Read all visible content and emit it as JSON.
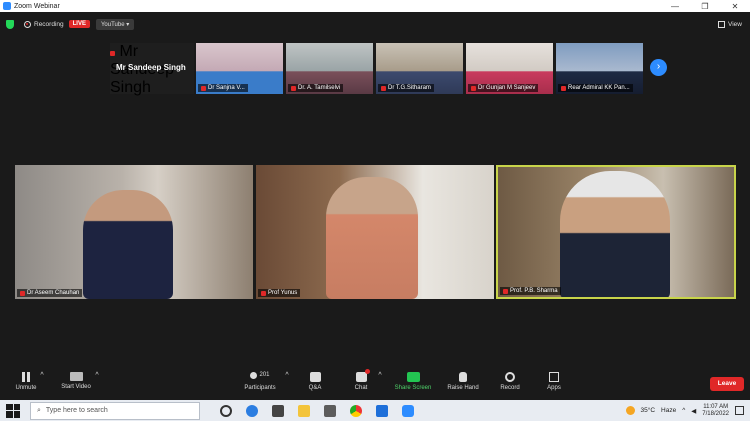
{
  "window": {
    "title": "Zoom Webinar",
    "controls": [
      "—",
      "❐",
      "✕"
    ]
  },
  "topbar": {
    "recording_label": "Recording",
    "live_badge": "LIVE",
    "stream_target": "YouTube ▾",
    "view_label": "View"
  },
  "gallery": {
    "name_only_tile": {
      "display_name": "Mr Sandeep Singh",
      "label": "Mr Sandeep Singh"
    },
    "strip": [
      {
        "label": "Dr Sanjna V..."
      },
      {
        "label": "Dr. A. Tamilselvi"
      },
      {
        "label": "Dr T.G.Sitharam"
      },
      {
        "label": "Dr Gunjan M Sanjeev"
      },
      {
        "label": "Rear Admiral KK Pan..."
      }
    ],
    "next_arrow": "›",
    "main": [
      {
        "label": "Dr Aseem Chauhan"
      },
      {
        "label": "Prof Yunus"
      },
      {
        "label": "Prof. P.B. Sharma"
      }
    ]
  },
  "toolbar": {
    "unmute": "Unmute",
    "start_video": "Start Video",
    "participants": "Participants",
    "participants_count": "201",
    "qa": "Q&A",
    "chat": "Chat",
    "share": "Share Screen",
    "raise": "Raise Hand",
    "record": "Record",
    "apps": "Apps",
    "leave": "Leave"
  },
  "taskbar": {
    "search_placeholder": "Type here to search",
    "weather_temp": "35°C",
    "weather_text": "Haze",
    "time": "11:07 AM",
    "date": "7/18/2022"
  },
  "colors": {
    "accent": "#2d8cff",
    "danger": "#e02828",
    "active_speaker": "#c8d44a"
  }
}
